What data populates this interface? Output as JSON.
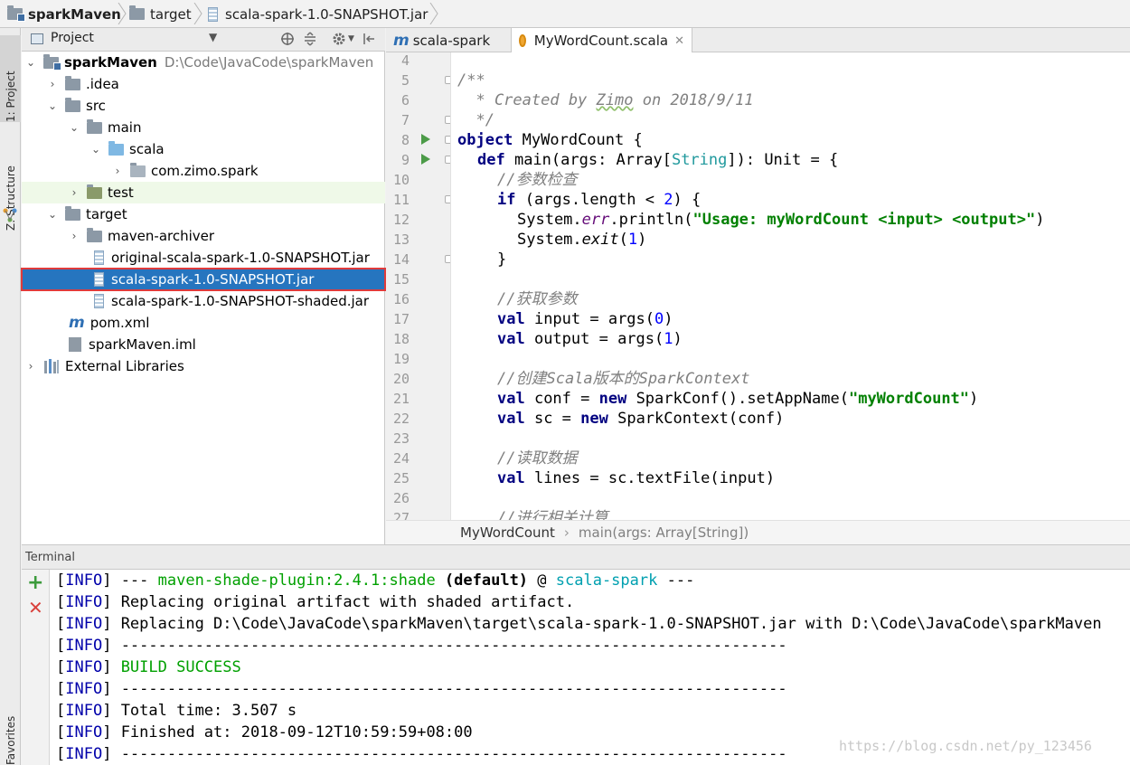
{
  "breadcrumb": [
    {
      "label": "sparkMaven",
      "icon": "project-folder-icon"
    },
    {
      "label": "target",
      "icon": "folder-icon"
    },
    {
      "label": "scala-spark-1.0-SNAPSHOT.jar",
      "icon": "jar-icon"
    }
  ],
  "side_tabs": {
    "project": "1: Project",
    "structure": "Z: Structure",
    "favorites": "Favorites"
  },
  "project_panel": {
    "title": "Project",
    "icons": [
      "locate-icon",
      "collapse-all-icon",
      "settings-icon",
      "hide-panel-icon"
    ]
  },
  "tree": {
    "root": {
      "label": "sparkMaven",
      "path": "D:\\Code\\JavaCode\\sparkMaven"
    },
    "idea": ".idea",
    "src": "src",
    "main": "main",
    "scala": "scala",
    "package": "com.zimo.spark",
    "test": "test",
    "target": "target",
    "maven_archiver": "maven-archiver",
    "jar_original": "original-scala-spark-1.0-SNAPSHOT.jar",
    "jar_selected": "scala-spark-1.0-SNAPSHOT.jar",
    "jar_shaded": "scala-spark-1.0-SNAPSHOT-shaded.jar",
    "pom": "pom.xml",
    "iml": "sparkMaven.iml",
    "external": "External Libraries"
  },
  "editor": {
    "tabs": [
      {
        "label": "scala-spark",
        "icon": "maven-m-icon",
        "active": false
      },
      {
        "label": "MyWordCount.scala",
        "icon": "scala-object-icon",
        "active": true
      }
    ],
    "line_numbers": [
      "4",
      "5",
      "6",
      "7",
      "8",
      "9",
      "10",
      "11",
      "12",
      "13",
      "14",
      "15",
      "16",
      "17",
      "18",
      "19",
      "20",
      "21",
      "22",
      "23",
      "24",
      "25",
      "26",
      "27"
    ],
    "code": {
      "l5": "/**",
      "l6_a": "  * Created by ",
      "l6_b": "Zimo",
      "l6_c": " on 2018/9/11",
      "l7": "  */",
      "l8_kw": "object",
      "l8_rest": " MyWordCount {",
      "l9_kw": "def",
      "l9_a": " main(args: Array[",
      "l9_type": "String",
      "l9_b": "]): Unit = {",
      "l10": "//参数检查",
      "l11_kw": "if",
      "l11_a": " (args.length < ",
      "l11_num": "2",
      "l11_b": ") {",
      "l12_a": "System.",
      "l12_err": "err",
      "l12_b": ".println(",
      "l12_str": "\"Usage: myWordCount <input> <output>\"",
      "l12_c": ")",
      "l13_a": "System.",
      "l13_exit": "exit",
      "l13_b": "(",
      "l13_num": "1",
      "l13_c": ")",
      "l14": "}",
      "l16": "//获取参数",
      "l17_kw": "val",
      "l17_a": " input = args(",
      "l17_num": "0",
      "l17_b": ")",
      "l18_kw": "val",
      "l18_a": " output = args(",
      "l18_num": "1",
      "l18_b": ")",
      "l20": "//创建Scala版本的SparkContext",
      "l21_kw": "val",
      "l21_a": " conf = ",
      "l21_new": "new",
      "l21_b": " SparkConf().setAppName(",
      "l21_str": "\"myWordCount\"",
      "l21_c": ")",
      "l22_kw": "val",
      "l22_a": " sc = ",
      "l22_new": "new",
      "l22_b": " SparkContext(conf)",
      "l24": "//读取数据",
      "l25_kw": "val",
      "l25_a": " lines = sc.textFile(input)",
      "l27": "//进行相关计算"
    },
    "breadcrumb": {
      "object": "MyWordCount",
      "method": "main(args: Array[String])"
    }
  },
  "terminal": {
    "title": "Terminal",
    "lines": {
      "t1_a": " --- ",
      "t1_plugin": "maven-shade-plugin:2.4.1:shade",
      "t1_b": " (default)",
      "t1_c": " @ ",
      "t1_project": "scala-spark",
      "t1_d": " ---",
      "t2": " Replacing original artifact with shaded artifact.",
      "t3": " Replacing D:\\Code\\JavaCode\\sparkMaven\\target\\scala-spark-1.0-SNAPSHOT.jar with D:\\Code\\JavaCode\\sparkMaven",
      "t4": " ------------------------------------------------------------------------",
      "t5": "BUILD SUCCESS",
      "t6": " ------------------------------------------------------------------------",
      "t7": " Total time: 3.507 s",
      "t8": " Finished at: 2018-09-12T10:59:59+08:00",
      "t9": " ------------------------------------------------------------------------"
    },
    "info_tag": "INFO"
  },
  "watermark": "https://blog.csdn.net/py_123456",
  "colors": {
    "selection": "#2675bf",
    "highlight_border": "#e03b3b",
    "run_icon": "#4c9b48",
    "terminal_green": "#00a000"
  }
}
